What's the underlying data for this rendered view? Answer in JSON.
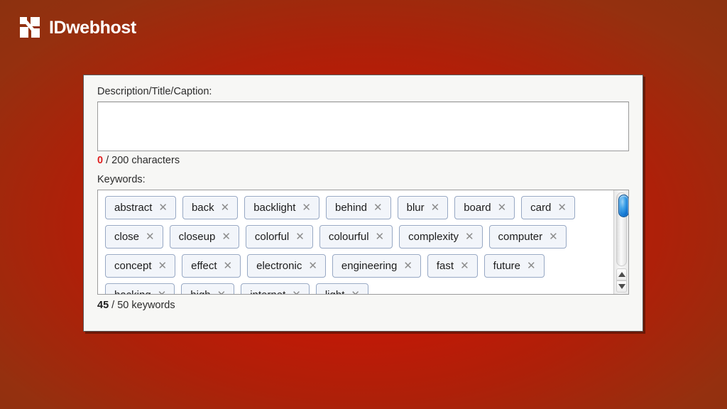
{
  "brand": {
    "name": "IDwebhost",
    "logo_icon": "idwebhost-squares-logo",
    "logo_color": "#ffffff"
  },
  "background": {
    "center_color": "#c31806",
    "edge_color": "#88320f"
  },
  "panel": {
    "description": {
      "label": "Description/Title/Caption:",
      "value": "",
      "placeholder": "",
      "counter_count": "0",
      "counter_rest": " / 200 characters",
      "counter_color": "#e02020",
      "max_characters": 200
    },
    "keywords": {
      "label": "Keywords:",
      "counter_count": "45",
      "counter_rest": " / 50 keywords",
      "used": 45,
      "max": 50,
      "remove_glyph": "✕",
      "rows": [
        [
          "abstract",
          "back",
          "backlight",
          "behind",
          "blur",
          "board"
        ],
        [
          "card",
          "close",
          "closeup",
          "colorful",
          "colourful",
          "complexity"
        ],
        [
          "computer",
          "concept",
          "effect",
          "electronic",
          "engineering"
        ],
        [
          "fast",
          "future",
          "hacking",
          "high",
          "internet",
          "light"
        ]
      ],
      "scrollbar": {
        "thumb_color": "#0f72cf",
        "up_arrow_icon": "triangle-up-icon",
        "down_arrow_icon": "triangle-down-icon"
      }
    }
  }
}
